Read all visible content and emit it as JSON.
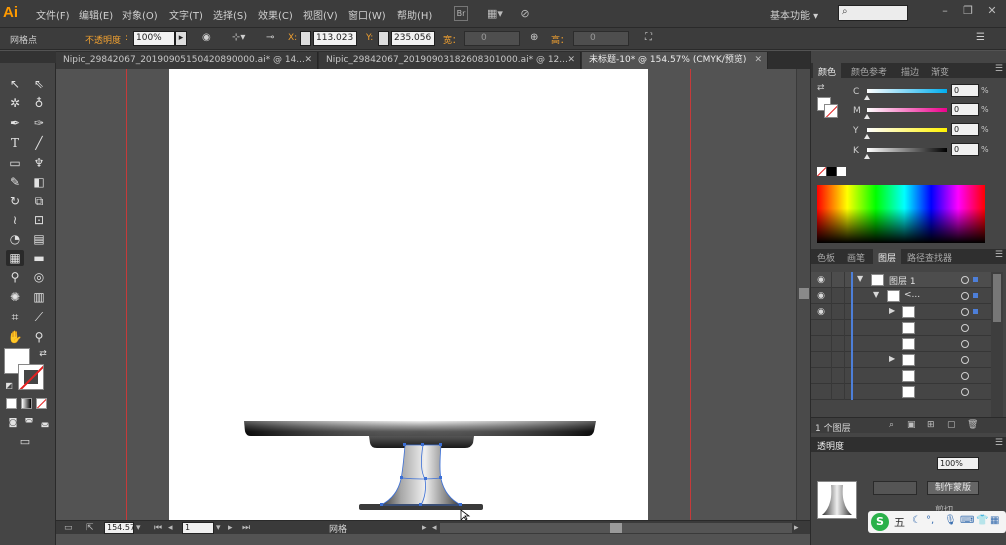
{
  "app": {
    "logo": "Ai",
    "menus": [
      "文件(F)",
      "编辑(E)",
      "对象(O)",
      "文字(T)",
      "选择(S)",
      "效果(C)",
      "视图(V)",
      "窗口(W)",
      "帮助(H)"
    ],
    "bridge_label": "Br",
    "workspace": "基本功能",
    "search_icon": "magnifier-icon"
  },
  "control_bar": {
    "selection_label": "网格点",
    "opacity_label": "不透明度",
    "opacity_value": "100%",
    "x_label": "X:",
    "x_value": "113.023",
    "y_label": "Y:",
    "y_value": "235.056",
    "w_label": "宽：",
    "w_value": "0",
    "h_label": "高：",
    "h_value": "0"
  },
  "tabs": [
    {
      "label": "Nipic_29842067_20190905150420890000.ai* @ 14..."
    },
    {
      "label": "Nipic_29842067_20190903182608301000.ai* @ 12..."
    },
    {
      "label": "未标题-10* @ 154.57% (CMYK/预览)"
    }
  ],
  "color_panel": {
    "tabs": [
      "颜色",
      "颜色参考",
      "描边",
      "渐变"
    ],
    "channels": [
      {
        "label": "C",
        "value": "0",
        "unit": "%",
        "color_start": "#ffffff",
        "color_end": "#00aeef",
        "level": 0
      },
      {
        "label": "M",
        "value": "0",
        "unit": "%",
        "color_start": "#ffffff",
        "color_end": "#ec008c",
        "level": 0
      },
      {
        "label": "Y",
        "value": "0",
        "unit": "%",
        "color_start": "#ffffff",
        "color_end": "#fff200",
        "level": 0
      },
      {
        "label": "K",
        "value": "0",
        "unit": "%",
        "color_start": "#ffffff",
        "color_end": "#000000",
        "level": 0
      }
    ]
  },
  "layers_panel": {
    "tabs": [
      "色板",
      "画笔",
      "图层",
      "路径查找器"
    ],
    "rows": [
      {
        "name": "图层 1",
        "visible": true,
        "expanded": true,
        "indent": 0
      },
      {
        "name": "<...",
        "visible": true,
        "expanded": true,
        "indent": 1
      },
      {
        "name": "",
        "visible": true,
        "expanded": false,
        "indent": 2
      },
      {
        "name": "",
        "visible": false,
        "expanded": null,
        "indent": 2
      },
      {
        "name": "",
        "visible": false,
        "expanded": null,
        "indent": 2
      },
      {
        "name": "",
        "visible": false,
        "expanded": false,
        "indent": 2
      },
      {
        "name": "",
        "visible": false,
        "expanded": null,
        "indent": 2
      },
      {
        "name": "",
        "visible": false,
        "expanded": null,
        "indent": 2
      }
    ],
    "count_label": "1 个图层"
  },
  "transparency_panel": {
    "title": "透明度",
    "opacity_value": "100%",
    "make_mask_button": "制作蒙版",
    "clip_label": "剪切"
  },
  "status_bar": {
    "zoom": "154.57",
    "page": "1",
    "tool_label": "网格"
  },
  "ime": {
    "logo": "S",
    "mode": "五"
  },
  "colors": {
    "accent_orange": "#ff9a00",
    "guide_red": "#c63a3a",
    "layer_blue": "#4d7fd9"
  }
}
